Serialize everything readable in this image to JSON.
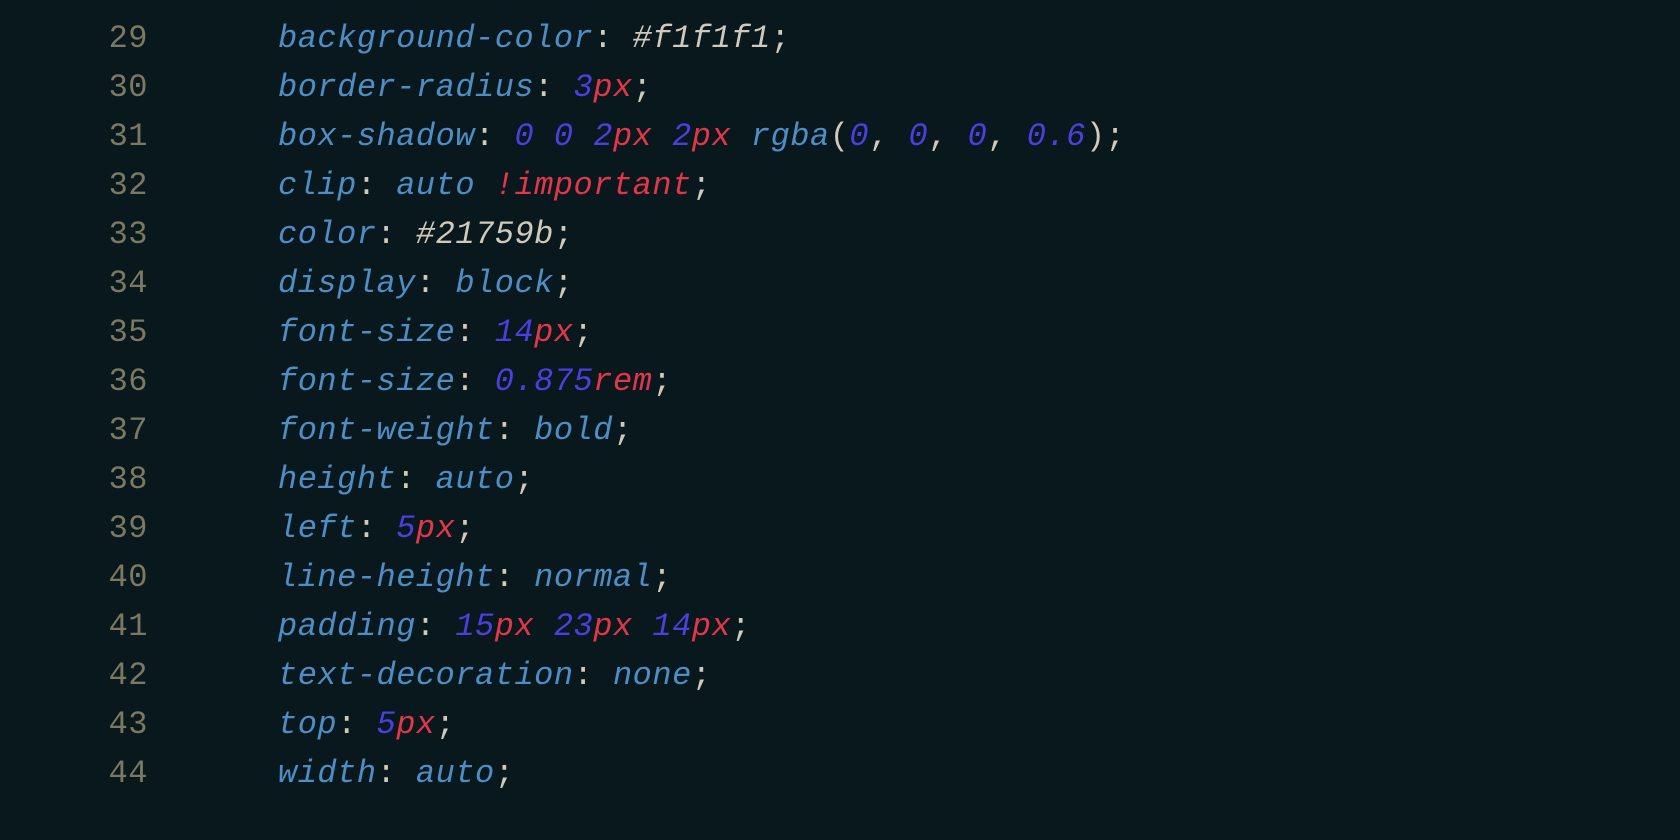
{
  "lines": [
    {
      "num": "29",
      "tokens": [
        {
          "cls": "prop",
          "t": "background-color"
        },
        {
          "cls": "punct",
          "t": ": "
        },
        {
          "cls": "hexv",
          "t": "#f1f1f1"
        },
        {
          "cls": "punct",
          "t": ";"
        }
      ]
    },
    {
      "num": "30",
      "tokens": [
        {
          "cls": "prop",
          "t": "border-radius"
        },
        {
          "cls": "punct",
          "t": ": "
        },
        {
          "cls": "numlit",
          "t": "3"
        },
        {
          "cls": "unit",
          "t": "px"
        },
        {
          "cls": "punct",
          "t": ";"
        }
      ]
    },
    {
      "num": "31",
      "tokens": [
        {
          "cls": "prop",
          "t": "box-shadow"
        },
        {
          "cls": "punct",
          "t": ": "
        },
        {
          "cls": "numlit",
          "t": "0"
        },
        {
          "cls": "punct",
          "t": " "
        },
        {
          "cls": "numlit",
          "t": "0"
        },
        {
          "cls": "punct",
          "t": " "
        },
        {
          "cls": "numlit",
          "t": "2"
        },
        {
          "cls": "unit",
          "t": "px"
        },
        {
          "cls": "punct",
          "t": " "
        },
        {
          "cls": "numlit",
          "t": "2"
        },
        {
          "cls": "unit",
          "t": "px"
        },
        {
          "cls": "punct",
          "t": " "
        },
        {
          "cls": "func",
          "t": "rgba"
        },
        {
          "cls": "punct",
          "t": "("
        },
        {
          "cls": "numlit",
          "t": "0"
        },
        {
          "cls": "punct",
          "t": ", "
        },
        {
          "cls": "numlit",
          "t": "0"
        },
        {
          "cls": "punct",
          "t": ", "
        },
        {
          "cls": "numlit",
          "t": "0"
        },
        {
          "cls": "punct",
          "t": ", "
        },
        {
          "cls": "numlit",
          "t": "0.6"
        },
        {
          "cls": "punct",
          "t": ");"
        }
      ]
    },
    {
      "num": "32",
      "tokens": [
        {
          "cls": "prop",
          "t": "clip"
        },
        {
          "cls": "punct",
          "t": ": "
        },
        {
          "cls": "value",
          "t": "auto"
        },
        {
          "cls": "punct",
          "t": " "
        },
        {
          "cls": "imp",
          "t": "!important"
        },
        {
          "cls": "punct",
          "t": ";"
        }
      ]
    },
    {
      "num": "33",
      "tokens": [
        {
          "cls": "prop",
          "t": "color"
        },
        {
          "cls": "punct",
          "t": ": "
        },
        {
          "cls": "hexv",
          "t": "#21759b"
        },
        {
          "cls": "punct",
          "t": ";"
        }
      ]
    },
    {
      "num": "34",
      "tokens": [
        {
          "cls": "prop",
          "t": "display"
        },
        {
          "cls": "punct",
          "t": ": "
        },
        {
          "cls": "value",
          "t": "block"
        },
        {
          "cls": "punct",
          "t": ";"
        }
      ]
    },
    {
      "num": "35",
      "tokens": [
        {
          "cls": "prop",
          "t": "font-size"
        },
        {
          "cls": "punct",
          "t": ": "
        },
        {
          "cls": "numlit",
          "t": "14"
        },
        {
          "cls": "unit",
          "t": "px"
        },
        {
          "cls": "punct",
          "t": ";"
        }
      ]
    },
    {
      "num": "36",
      "tokens": [
        {
          "cls": "prop",
          "t": "font-size"
        },
        {
          "cls": "punct",
          "t": ": "
        },
        {
          "cls": "numlit",
          "t": "0.875"
        },
        {
          "cls": "unit",
          "t": "rem"
        },
        {
          "cls": "punct",
          "t": ";"
        }
      ]
    },
    {
      "num": "37",
      "tokens": [
        {
          "cls": "prop",
          "t": "font-weight"
        },
        {
          "cls": "punct",
          "t": ": "
        },
        {
          "cls": "value",
          "t": "bold"
        },
        {
          "cls": "punct",
          "t": ";"
        }
      ]
    },
    {
      "num": "38",
      "tokens": [
        {
          "cls": "prop",
          "t": "height"
        },
        {
          "cls": "punct",
          "t": ": "
        },
        {
          "cls": "value",
          "t": "auto"
        },
        {
          "cls": "punct",
          "t": ";"
        }
      ]
    },
    {
      "num": "39",
      "tokens": [
        {
          "cls": "prop",
          "t": "left"
        },
        {
          "cls": "punct",
          "t": ": "
        },
        {
          "cls": "numlit",
          "t": "5"
        },
        {
          "cls": "unit",
          "t": "px"
        },
        {
          "cls": "punct",
          "t": ";"
        }
      ]
    },
    {
      "num": "40",
      "tokens": [
        {
          "cls": "prop",
          "t": "line-height"
        },
        {
          "cls": "punct",
          "t": ": "
        },
        {
          "cls": "value",
          "t": "normal"
        },
        {
          "cls": "punct",
          "t": ";"
        }
      ]
    },
    {
      "num": "41",
      "tokens": [
        {
          "cls": "prop",
          "t": "padding"
        },
        {
          "cls": "punct",
          "t": ": "
        },
        {
          "cls": "numlit",
          "t": "15"
        },
        {
          "cls": "unit",
          "t": "px"
        },
        {
          "cls": "punct",
          "t": " "
        },
        {
          "cls": "numlit",
          "t": "23"
        },
        {
          "cls": "unit",
          "t": "px"
        },
        {
          "cls": "punct",
          "t": " "
        },
        {
          "cls": "numlit",
          "t": "14"
        },
        {
          "cls": "unit",
          "t": "px"
        },
        {
          "cls": "punct",
          "t": ";"
        }
      ]
    },
    {
      "num": "42",
      "tokens": [
        {
          "cls": "prop",
          "t": "text-decoration"
        },
        {
          "cls": "punct",
          "t": ": "
        },
        {
          "cls": "value",
          "t": "none"
        },
        {
          "cls": "punct",
          "t": ";"
        }
      ]
    },
    {
      "num": "43",
      "tokens": [
        {
          "cls": "prop",
          "t": "top"
        },
        {
          "cls": "punct",
          "t": ": "
        },
        {
          "cls": "numlit",
          "t": "5"
        },
        {
          "cls": "unit",
          "t": "px"
        },
        {
          "cls": "punct",
          "t": ";"
        }
      ]
    },
    {
      "num": "44",
      "tokens": [
        {
          "cls": "prop",
          "t": "width"
        },
        {
          "cls": "punct",
          "t": ": "
        },
        {
          "cls": "value",
          "t": "auto"
        },
        {
          "cls": "punct",
          "t": ";"
        }
      ]
    }
  ]
}
